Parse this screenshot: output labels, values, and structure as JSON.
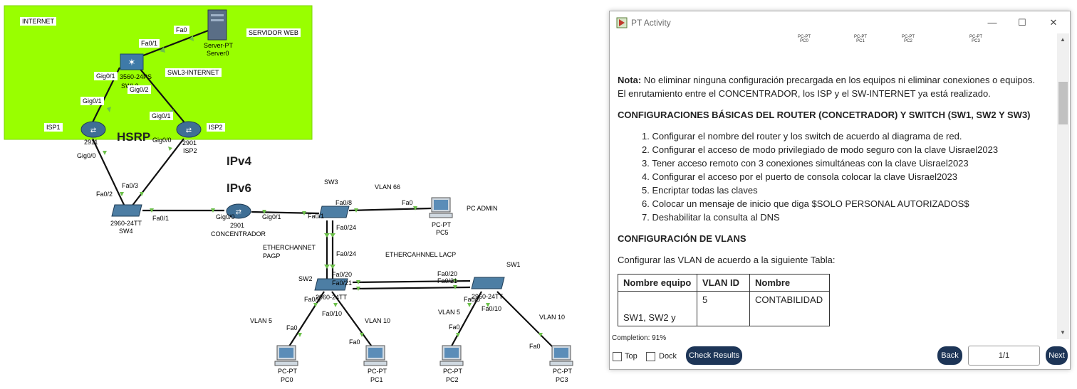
{
  "topology": {
    "zone_internet_label": "INTERNET",
    "server_web_label": "SERVIDOR WEB",
    "swl3_internet_label": "SWL3-INTERNET",
    "hsrp_label": "HSRP",
    "ipv4_label": "IPv4",
    "ipv6_label": "IPv6",
    "etherchannel_pagp_1": "ETHERCHANNET",
    "etherchannel_pagp_2": "PAGP",
    "etherchannel_lacp": "ETHERCAHNNEL LACP",
    "pc_admin_label": "PC ADMIN",
    "vlan66": "VLAN 66",
    "vlan5_a": "VLAN 5",
    "vlan10_a": "VLAN 10",
    "vlan5_b": "VLAN 5",
    "vlan10_b": "VLAN 10",
    "devices": {
      "server": {
        "model": "Server-PT",
        "name": "Server0"
      },
      "swl3": {
        "model": "3560-24PS",
        "name": "SWL3"
      },
      "isp1": {
        "tag": "ISP1",
        "model": "2911",
        "name": "ISP1"
      },
      "isp2": {
        "tag": "ISP2",
        "model": "2901",
        "name": "ISP2"
      },
      "sw4": {
        "model": "2960-24TT",
        "name": "SW4"
      },
      "conc": {
        "model": "2901",
        "name": "CONCENTRADOR"
      },
      "sw3": {
        "name": "SW3"
      },
      "pc5": {
        "model": "PC-PT",
        "name": "PC5"
      },
      "sw2": {
        "tag": "SW2",
        "model": "2960-24TT",
        "name": "SW2"
      },
      "sw1": {
        "tag": "SW1",
        "model": "2960-24TT",
        "name": "SW1"
      },
      "pc0": {
        "model": "PC-PT",
        "name": "PC0"
      },
      "pc1": {
        "model": "PC-PT",
        "name": "PC1"
      },
      "pc2": {
        "model": "PC-PT",
        "name": "PC2"
      },
      "pc3": {
        "model": "PC-PT",
        "name": "PC3"
      }
    },
    "ports": {
      "fa0_server": "Fa0",
      "fa01_swl3": "Fa0/1",
      "gig01_swl3": "Gig0/1",
      "gig02_swl3": "Gig0/2",
      "gig01_isp1": "Gig0/1",
      "gig01_isp2": "Gig0/1",
      "gig00_isp1": "Gig0/0",
      "gig00_isp2": "Gig0/0",
      "fa02_sw4": "Fa0/2",
      "fa03_sw4": "Fa0/3",
      "fa01_sw4": "Fa0/1",
      "gig00_conc": "Gig0/0",
      "gig01_conc": "Gig0/1",
      "fa01_sw3": "Fa0/1",
      "fa08_sw3": "Fa0/8",
      "fa0_pc5": "Fa0",
      "fa024_sw3": "Fa0/24",
      "fa024_sw2": "Fa0/24",
      "fa020_sw2": "Fa0/20",
      "fa021_sw2": "Fa0/21",
      "fa020_sw1": "Fa0/20",
      "fa021_sw1": "Fa0/21",
      "fa05_sw2": "Fa0/5",
      "fa010_sw2": "Fa0/10",
      "fa05_sw1": "Fa0/5",
      "fa010_sw1": "Fa0/10",
      "fa0_pc0": "Fa0",
      "fa0_pc1": "Fa0",
      "fa0_pc2": "Fa0",
      "fa0_pc3": "Fa0"
    }
  },
  "window": {
    "title": "PT Activity",
    "thumb_pcs": [
      {
        "model": "PC-PT",
        "name": "PC0"
      },
      {
        "model": "PC-PT",
        "name": "PC1"
      },
      {
        "model": "PC-PT",
        "name": "PC2"
      },
      {
        "model": "PC-PT",
        "name": "PC3"
      }
    ],
    "note_bold": "Nota:",
    "note_rest": " No eliminar ninguna configuración precargada en los equipos ni eliminar conexiones o equipos.",
    "note_line2": "El enrutamiento entre el CONCENTRADOR, los ISP y el SW-INTERNET ya está realizado.",
    "heading_basic": "CONFIGURACIONES BÁSICAS DEL ROUTER (CONCETRADOR) Y SWITCH (SW1, SW2 Y SW3)",
    "steps": [
      "1. Configurar el nombre del router y los switch de acuerdo al diagrama de red.",
      "2. Configurar el acceso de modo privilegiado de modo seguro con la clave Uisrael2023",
      "3. Tener acceso remoto con 3 conexiones simultáneas con la clave Uisrael2023",
      "4. Configurar el acceso por el puerto de consola colocar la clave Uisrael2023",
      "5. Encriptar todas las claves",
      "6. Colocar un mensaje de inicio que diga $SOLO PERSONAL AUTORIZADOS$",
      "7. Deshabilitar la consulta al DNS"
    ],
    "heading_vlans": "CONFIGURACIÓN DE VLANS",
    "vlan_intro": "Configurar las VLAN de acuerdo a la siguiente Tabla:",
    "table": {
      "headers": [
        "Nombre equipo",
        "VLAN ID",
        "Nombre"
      ],
      "row1": [
        "SW1, SW2 y",
        "5",
        "CONTABILIDAD"
      ]
    },
    "completion": "Completion: 91%",
    "top_label": "Top",
    "dock_label": "Dock",
    "check_results": "Check Results",
    "back": "Back",
    "page_indicator": "1/1",
    "next": "Next"
  },
  "colors": {
    "internet_zone": "#99ff00",
    "button_dark": "#1d3557",
    "link_dot": "#6cc04a"
  }
}
